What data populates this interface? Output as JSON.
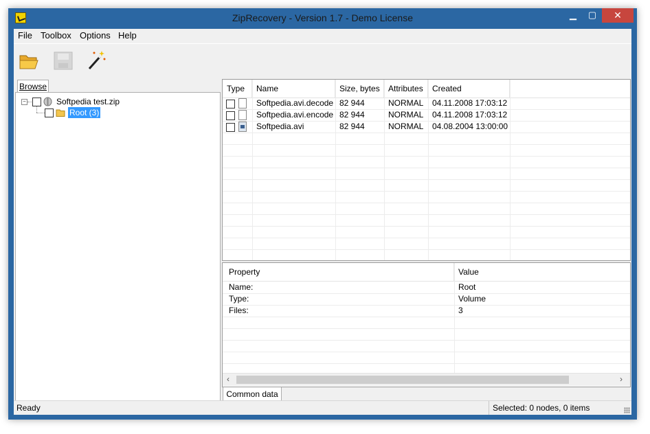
{
  "window": {
    "title": "ZipRecovery - Version 1.7 - Demo License",
    "min_glyph": "▁",
    "max_glyph": "▢",
    "close_glyph": "✕"
  },
  "menu": {
    "file": "File",
    "toolbox": "Toolbox",
    "options": "Options",
    "help": "Help"
  },
  "toolbar": {
    "icons": [
      "open-folder-icon",
      "save-icon",
      "magic-wand-icon"
    ]
  },
  "left_pane": {
    "tab_label": "Browse",
    "expander_glyph": "−",
    "tree": [
      {
        "label": "Softpedia test.zip",
        "icon": "zip-archive-icon"
      },
      {
        "label": "Root (3)",
        "icon": "folder-icon",
        "selected": true
      }
    ]
  },
  "files": {
    "columns": [
      "Type",
      "Name",
      "Size, bytes",
      "Attributes",
      "Created"
    ],
    "rows": [
      {
        "name": "Softpedia.avi.decode",
        "size": "82 944",
        "attributes": "NORMAL",
        "created": "04.11.2008 17:03:12",
        "icon": "file-icon"
      },
      {
        "name": "Softpedia.avi.encode",
        "size": "82 944",
        "attributes": "NORMAL",
        "created": "04.11.2008 17:03:12",
        "icon": "file-icon"
      },
      {
        "name": "Softpedia.avi",
        "size": "82 944",
        "attributes": "NORMAL",
        "created": "04.08.2004 13:00:00",
        "icon": "video-file-icon"
      }
    ]
  },
  "properties": {
    "columns": [
      "Property",
      "Value"
    ],
    "rows": [
      {
        "property": "Name:",
        "value": "Root"
      },
      {
        "property": "Type:",
        "value": "Volume"
      },
      {
        "property": "Files:",
        "value": "3"
      }
    ],
    "scroll_left": "‹",
    "scroll_right": "›"
  },
  "bottom_tab": {
    "label": "Common data"
  },
  "status": {
    "left": "Ready",
    "right": "Selected: 0 nodes, 0 items"
  }
}
